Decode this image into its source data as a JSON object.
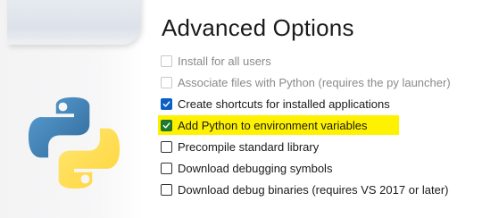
{
  "page": {
    "title": "Advanced Options"
  },
  "options": [
    {
      "label": "Install for all users",
      "checked": false,
      "enabled": false,
      "highlighted": false
    },
    {
      "label": "Associate files with Python (requires the py launcher)",
      "checked": false,
      "enabled": false,
      "highlighted": false
    },
    {
      "label": "Create shortcuts for installed applications",
      "checked": true,
      "enabled": true,
      "highlighted": false
    },
    {
      "label": "Add Python to environment variables",
      "checked": true,
      "enabled": true,
      "highlighted": true
    },
    {
      "label": "Precompile standard library",
      "checked": false,
      "enabled": true,
      "highlighted": false
    },
    {
      "label": "Download debugging symbols",
      "checked": false,
      "enabled": true,
      "highlighted": false
    },
    {
      "label": "Download debug binaries (requires VS 2017 or later)",
      "checked": false,
      "enabled": true,
      "highlighted": false
    }
  ],
  "colors": {
    "highlight": "#fff200",
    "checkbox_blue": "#0a5ec8",
    "checkbox_green": "#1f7a2e",
    "python_blue": "#3776ab",
    "python_yellow": "#ffd43b"
  },
  "icons": {
    "logo": "python-logo-icon"
  }
}
